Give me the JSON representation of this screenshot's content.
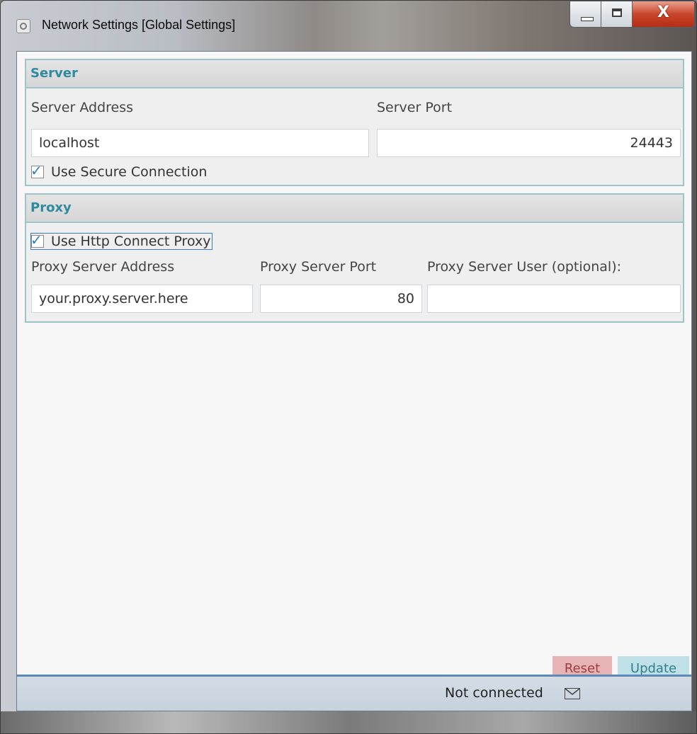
{
  "window": {
    "title": "Network Settings [Global Settings]",
    "close_glyph": "X"
  },
  "server": {
    "header": "Server",
    "address_label": "Server Address",
    "port_label": "Server Port",
    "address_value": "localhost",
    "port_value": "24443",
    "secure_label": "Use Secure Connection",
    "secure_checked": true
  },
  "proxy": {
    "header": "Proxy",
    "use_proxy_label": "Use Http Connect Proxy",
    "use_proxy_checked": true,
    "address_label": "Proxy Server Address",
    "port_label": "Proxy Server Port",
    "user_label": "Proxy Server User (optional):",
    "address_value": "your.proxy.server.here",
    "port_value": "80",
    "user_value": ""
  },
  "actions": {
    "reset_label": "Reset",
    "update_label": "Update"
  },
  "status": {
    "text": "Not connected",
    "icon": "mail-icon"
  },
  "colors": {
    "accent": "#2e8aa0",
    "group_border": "#9cc4ca",
    "reset": "#b03a3a",
    "update": "#4a9fb0",
    "check": "#2a7fc3"
  }
}
